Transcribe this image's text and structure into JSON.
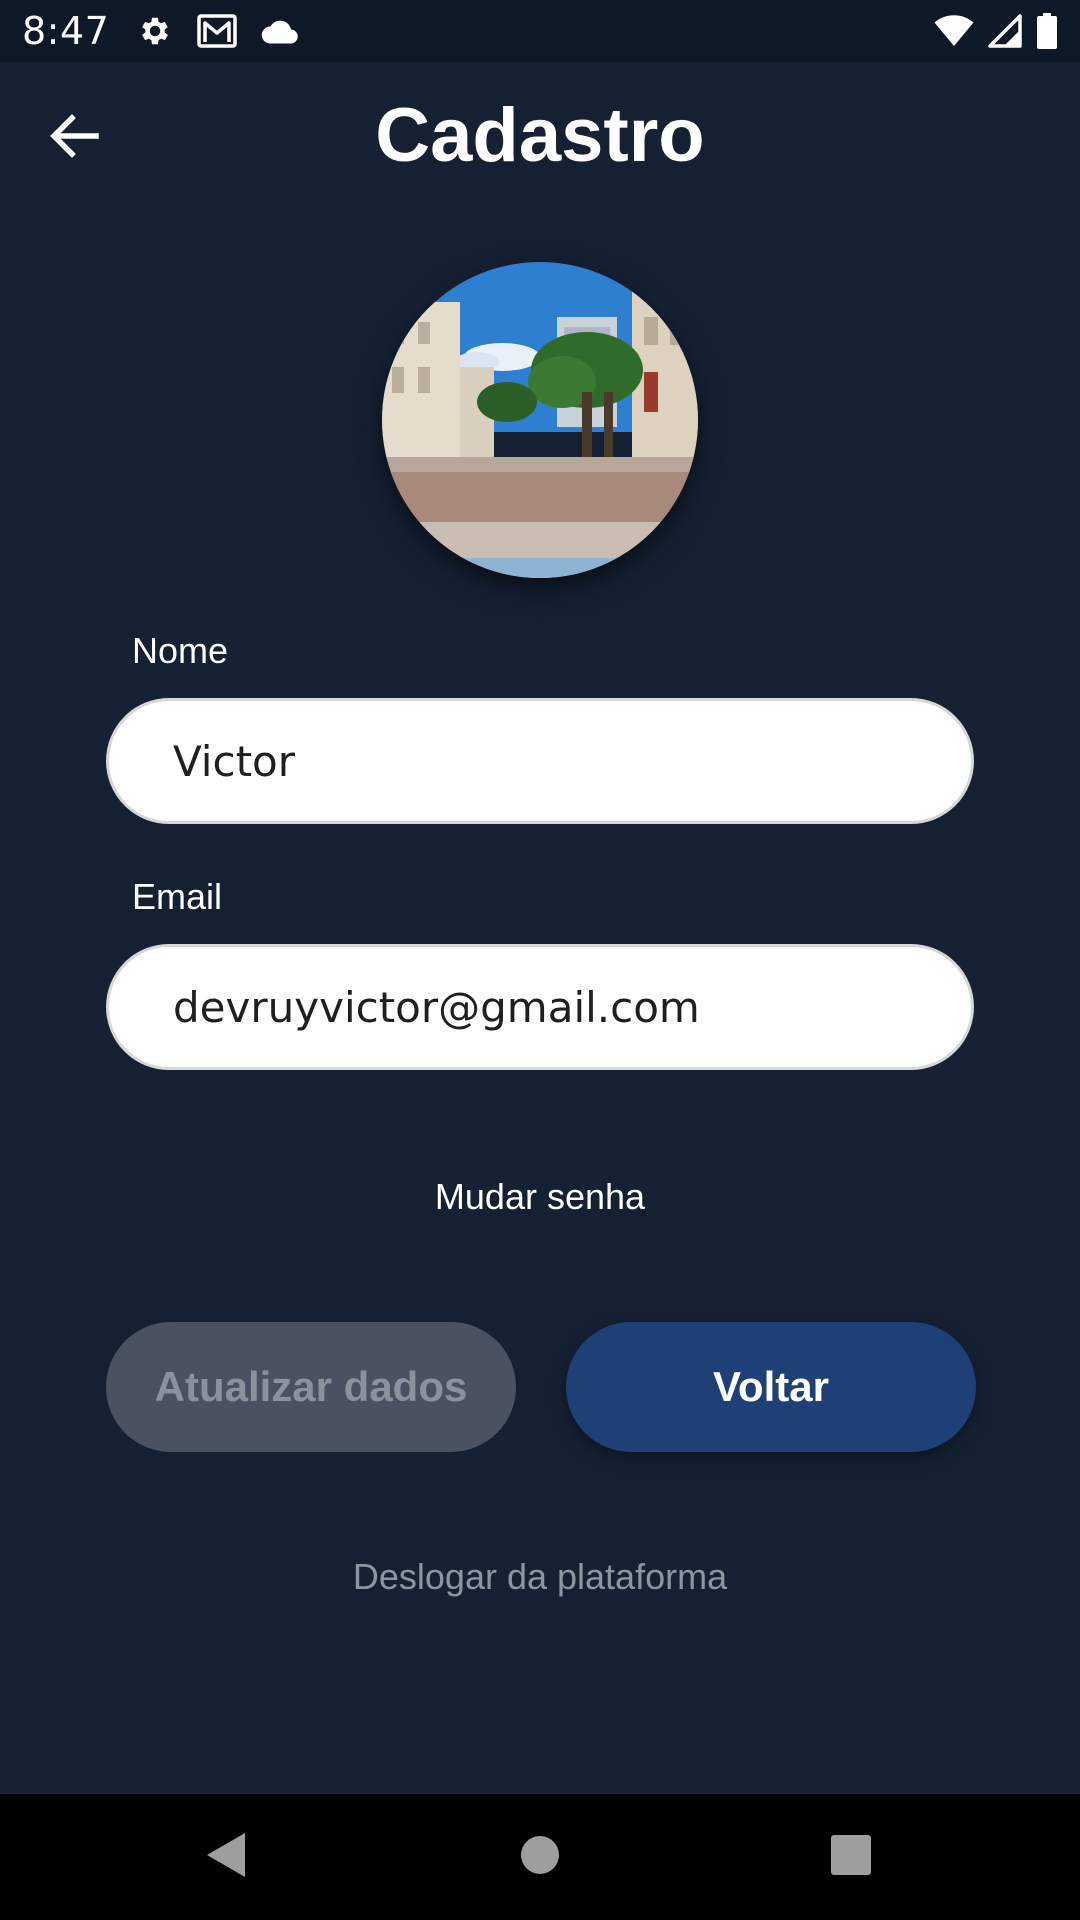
{
  "status_bar": {
    "time": "8:47",
    "left_icons": [
      "settings-icon",
      "gmail-icon",
      "cloud-icon"
    ],
    "right_icons": [
      "wifi-icon",
      "signal-icon",
      "battery-icon"
    ]
  },
  "app_bar": {
    "title": "Cadastro",
    "back_icon": "arrow-back-icon"
  },
  "profile": {
    "avatar_description": "street-photo-avatar"
  },
  "form": {
    "name_label": "Nome",
    "name_value": "Victor",
    "email_label": "Email",
    "email_value": "devruyvictor@gmail.com"
  },
  "actions": {
    "change_password": "Mudar senha",
    "update_button": "Atualizar dados",
    "back_button": "Voltar",
    "logout": "Deslogar da plataforma"
  },
  "navigation": {
    "icons": [
      "nav-back-icon",
      "nav-home-icon",
      "nav-recents-icon"
    ]
  },
  "colors": {
    "background": "#152033",
    "primary_button": "#1f4077",
    "disabled_button": "#4a5261",
    "muted_text": "#8f95a0"
  }
}
